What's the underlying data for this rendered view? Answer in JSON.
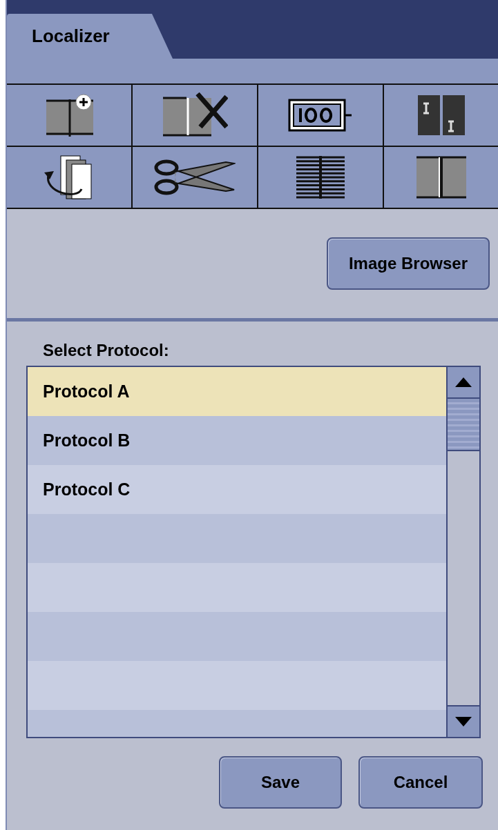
{
  "tabs": [
    {
      "label": "Localizer",
      "selected": true
    }
  ],
  "tools": [
    {
      "kind": "add-image"
    },
    {
      "kind": "delete-image"
    },
    {
      "kind": "zoom-100"
    },
    {
      "kind": "compare"
    },
    {
      "kind": "cycle"
    },
    {
      "kind": "cut"
    },
    {
      "kind": "lines"
    },
    {
      "kind": "split"
    }
  ],
  "image_browser_button": "Image Browser",
  "protocol_label": "Select Protocol:",
  "protocols": [
    {
      "label": "Protocol A",
      "selected": true
    },
    {
      "label": "Protocol B",
      "selected": false
    },
    {
      "label": "Protocol C",
      "selected": false
    }
  ],
  "buttons": [
    "Save",
    "Cancel"
  ]
}
